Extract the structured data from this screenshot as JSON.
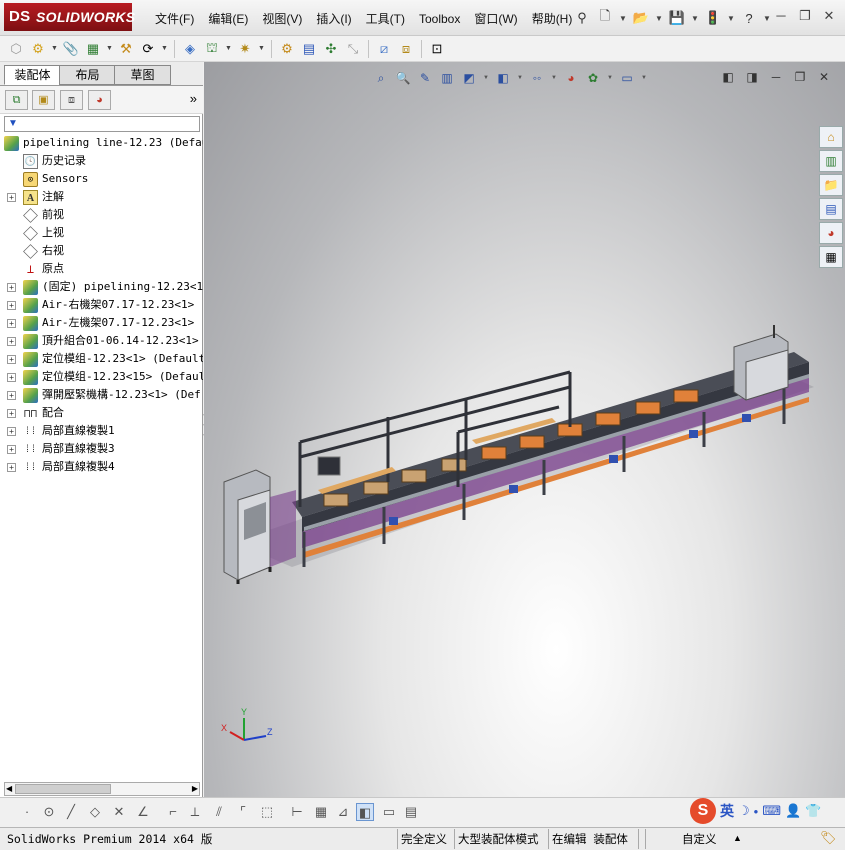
{
  "app": {
    "brand_ds": "DS",
    "brand": "SOLIDWORKS"
  },
  "menu": [
    "文件(F)",
    "编辑(E)",
    "视图(V)",
    "插入(I)",
    "工具(T)",
    "Toolbox",
    "窗口(W)",
    "帮助(H)"
  ],
  "window_controls": {
    "minimize": "─",
    "restore": "❐",
    "close": "✕"
  },
  "tabs": [
    "装配体",
    "布局",
    "草图"
  ],
  "filter": "▼",
  "more": "»",
  "tree": {
    "root": "pipelining line-12.23  (Default",
    "items": [
      {
        "label": "历史记录",
        "icon": "history-icon"
      },
      {
        "label": "Sensors",
        "icon": "sensors-icon"
      },
      {
        "label": "注解",
        "icon": "annotations-icon",
        "exp": true
      },
      {
        "label": "前视",
        "icon": "plane-icon"
      },
      {
        "label": "上视",
        "icon": "plane-icon"
      },
      {
        "label": "右视",
        "icon": "plane-icon"
      },
      {
        "label": "原点",
        "icon": "origin-icon"
      },
      {
        "label": "(固定) pipelining-12.23<1>",
        "icon": "assembly-icon",
        "exp": true
      },
      {
        "label": "Air-右機架07.17-12.23<1>  (",
        "icon": "assembly-icon",
        "exp": true
      },
      {
        "label": "Air-左機架07.17-12.23<1>  (",
        "icon": "assembly-icon",
        "exp": true
      },
      {
        "label": "頂升組合01-06.14-12.23<1>",
        "icon": "assembly-icon",
        "exp": true
      },
      {
        "label": "定位模组-12.23<1>  (Default",
        "icon": "assembly-icon",
        "exp": true
      },
      {
        "label": "定位模组-12.23<15>  (Defaul",
        "icon": "assembly-icon",
        "exp": true
      },
      {
        "label": "彈開壓緊機構-12.23<1>  (Def",
        "icon": "assembly-icon",
        "exp": true
      },
      {
        "label": "配合",
        "icon": "mates-icon",
        "exp": true
      },
      {
        "label": "局部直線複製1",
        "icon": "pattern-icon",
        "exp": true
      },
      {
        "label": "局部直線複製3",
        "icon": "pattern-icon",
        "exp": true
      },
      {
        "label": "局部直線複製4",
        "icon": "pattern-icon",
        "exp": true
      }
    ]
  },
  "triad": {
    "x": "X",
    "y": "Y",
    "z": "Z"
  },
  "ime": {
    "lang": "英"
  },
  "status": {
    "product": "SolidWorks Premium 2014 x64 版",
    "state": "完全定义",
    "mode": "大型装配体模式",
    "editing": "在编辑 装配体",
    "units": "自定义"
  },
  "colors": {
    "brand_red": "#a8171c",
    "frame_gray": "#4a4d56",
    "accent_orange": "#e0813a",
    "purple": "#7a3f8c"
  }
}
